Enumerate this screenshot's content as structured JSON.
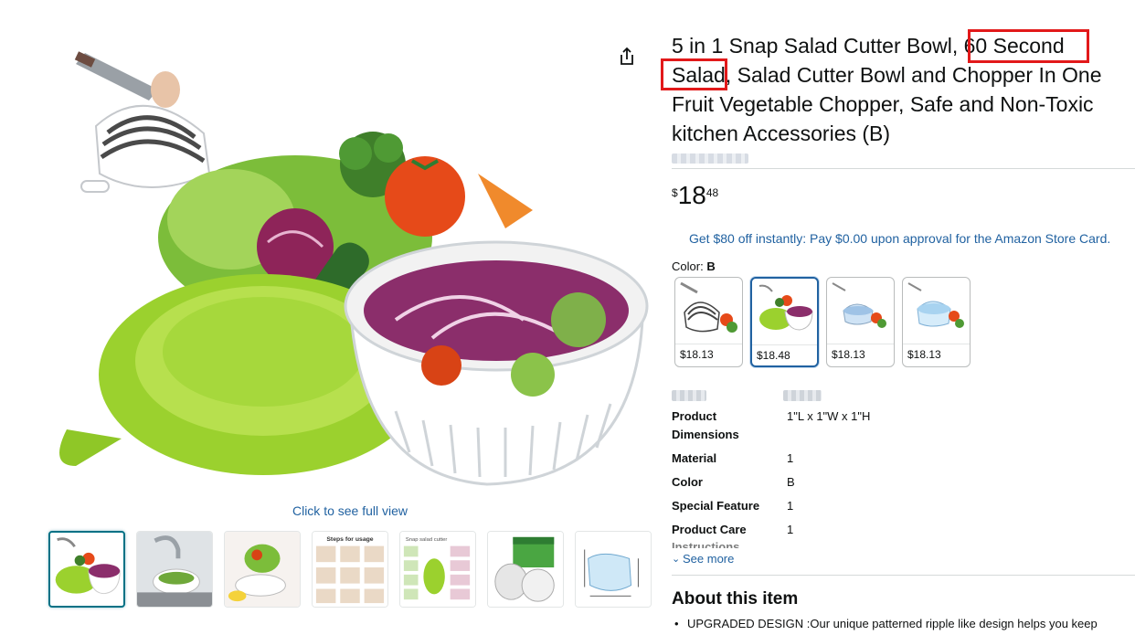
{
  "gallery": {
    "full_view_link": "Click to see full view",
    "thumbnails": [
      {
        "name": "bowl-with-vegetables"
      },
      {
        "name": "washing-in-sink"
      },
      {
        "name": "tossing-salad"
      },
      {
        "name": "steps-for-usage",
        "caption": "Steps for usage"
      },
      {
        "name": "snap-salad-cutter-features",
        "caption": "Snap salad cutter"
      },
      {
        "name": "product-box"
      },
      {
        "name": "dimensions-diagram"
      }
    ]
  },
  "product": {
    "title_before": "5 in 1 Snap Salad Cutter Bowl,",
    "title_highlight": "60 Second Salad",
    "title_after": ", Salad Cutter Bowl and Chopper In One Fruit Vegetable Chopper, Safe and Non-Toxic kitchen Accessories (B)",
    "price": {
      "symbol": "$",
      "whole": "18",
      "fraction": "48"
    },
    "promo": "Get $80 off instantly: Pay $0.00 upon approval for the Amazon Store Card.",
    "color_label": "Color:",
    "color_value": "B",
    "swatches": [
      {
        "price": "$18.13",
        "selected": false
      },
      {
        "price": "$18.48",
        "selected": true
      },
      {
        "price": "$18.13",
        "selected": false
      },
      {
        "price": "$18.13",
        "selected": false
      }
    ],
    "specs": [
      {
        "key": "Product Dimensions",
        "value": "1\"L x 1\"W x 1\"H"
      },
      {
        "key": "Material",
        "value": "1"
      },
      {
        "key": "Color",
        "value": "B"
      },
      {
        "key": "Special Feature",
        "value": "1"
      },
      {
        "key": "Product Care",
        "value": "1"
      }
    ],
    "spec_cutoff": "Instructions",
    "see_more": "See more",
    "about_title": "About this item",
    "bullets": [
      "UPGRADED DESIGN :Our unique patterned ripple like design helps you keep"
    ]
  },
  "colors": {
    "link": "#2162a1",
    "highlight_box": "#e2191a",
    "selected_border": "#007185",
    "bowl_green": "#9bd12e"
  }
}
